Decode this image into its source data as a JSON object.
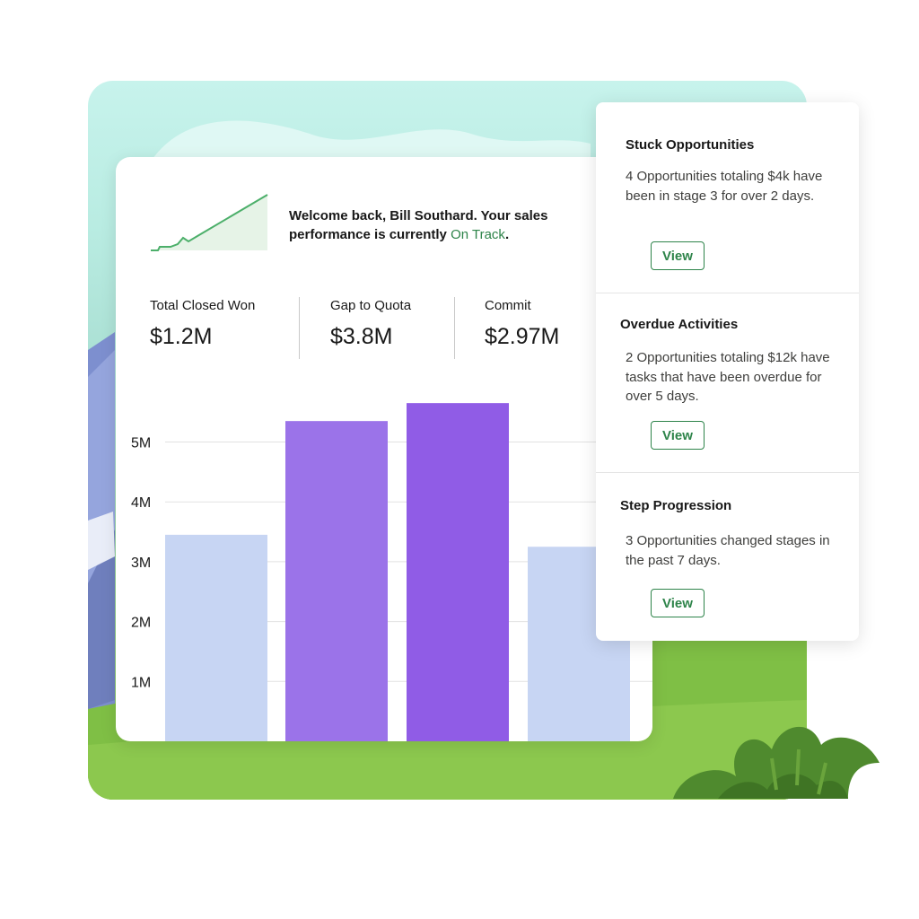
{
  "welcome": {
    "text": "Welcome back, Bill Southard. Your sales performance is currently",
    "status": "On Track",
    "punct": "."
  },
  "kpis": [
    {
      "label": "Total Closed Won",
      "value": "$1.2M"
    },
    {
      "label": "Gap to Quota",
      "value": "$3.8M"
    },
    {
      "label": "Commit",
      "value": "$2.97M"
    }
  ],
  "chart_data": {
    "type": "bar",
    "values": [
      3.45,
      5.35,
      5.65,
      3.25
    ],
    "colors": [
      "#c7d5f3",
      "#9b73e9",
      "#905ce6",
      "#c7d5f3"
    ],
    "yticks": [
      "5M",
      "4M",
      "3M",
      "2M",
      "1M"
    ],
    "ytick_values": [
      5,
      4,
      3,
      2,
      1
    ],
    "ylim": [
      0,
      6
    ],
    "grid": true
  },
  "panel": {
    "sections": [
      {
        "title": "Stuck Opportunities",
        "body": "4 Opportunities totaling $4k have been in stage 3  for over 2 days.",
        "button": "View"
      },
      {
        "title": "Overdue Activities",
        "body": "2 Opportunities totaling $12k have tasks that have been overdue for over 5 days.",
        "button": "View"
      },
      {
        "title": "Step Progression",
        "body": "3 Opportunities changed stages in the past 7 days.",
        "button": "View"
      }
    ]
  },
  "colors": {
    "accent_green": "#2e844a",
    "sparkline": "#4caf6a"
  },
  "icons": [
    "sparkline-trend-icon"
  ]
}
